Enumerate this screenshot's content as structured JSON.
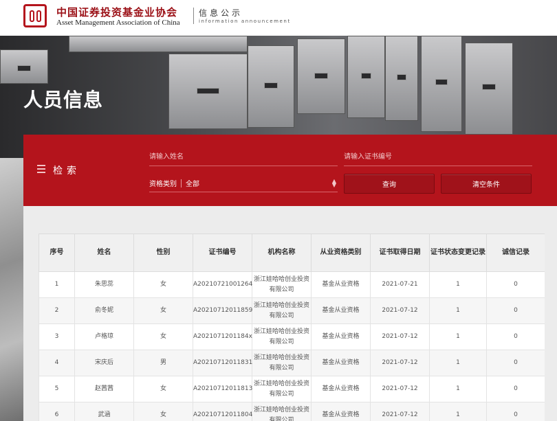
{
  "header": {
    "org_name_cn": "中国证券投资基金业协会",
    "org_name_en": "Asset Management Association of China",
    "section_cn": "信息公示",
    "section_en": "information announcement"
  },
  "hero": {
    "title": "人员信息"
  },
  "search": {
    "title": "检索",
    "name_placeholder": "请输入姓名",
    "cert_placeholder": "请输入证书编号",
    "qualification_label": "资格类别",
    "qualification_value": "全部",
    "query_button": "查询",
    "clear_button": "清空条件"
  },
  "table": {
    "columns": [
      "序号",
      "姓名",
      "性别",
      "证书编号",
      "机构名称",
      "从业资格类别",
      "证书取得日期",
      "证书状态变更记录",
      "诚信记录"
    ],
    "rows": [
      [
        "1",
        "朱思蕊",
        "女",
        "A20210721001264",
        "浙江娃哈哈创业投资有限公司",
        "基金从业资格",
        "2021-07-21",
        "1",
        "0"
      ],
      [
        "2",
        "俞冬妮",
        "女",
        "A20210712011859",
        "浙江娃哈哈创业投资有限公司",
        "基金从业资格",
        "2021-07-12",
        "1",
        "0"
      ],
      [
        "3",
        "卢格琼",
        "女",
        "A2021071201184x",
        "浙江娃哈哈创业投资有限公司",
        "基金从业资格",
        "2021-07-12",
        "1",
        "0"
      ],
      [
        "4",
        "宋庆后",
        "男",
        "A20210712011831",
        "浙江娃哈哈创业投资有限公司",
        "基金从业资格",
        "2021-07-12",
        "1",
        "0"
      ],
      [
        "5",
        "赵茜茜",
        "女",
        "A20210712011813",
        "浙江娃哈哈创业投资有限公司",
        "基金从业资格",
        "2021-07-12",
        "1",
        "0"
      ],
      [
        "6",
        "武涵",
        "女",
        "A20210712011804",
        "浙江娃哈哈创业投资有限公司",
        "基金从业资格",
        "2021-07-12",
        "1",
        "0"
      ]
    ]
  },
  "colors": {
    "brand_red": "#b4141c",
    "button_red": "#a0121a"
  }
}
